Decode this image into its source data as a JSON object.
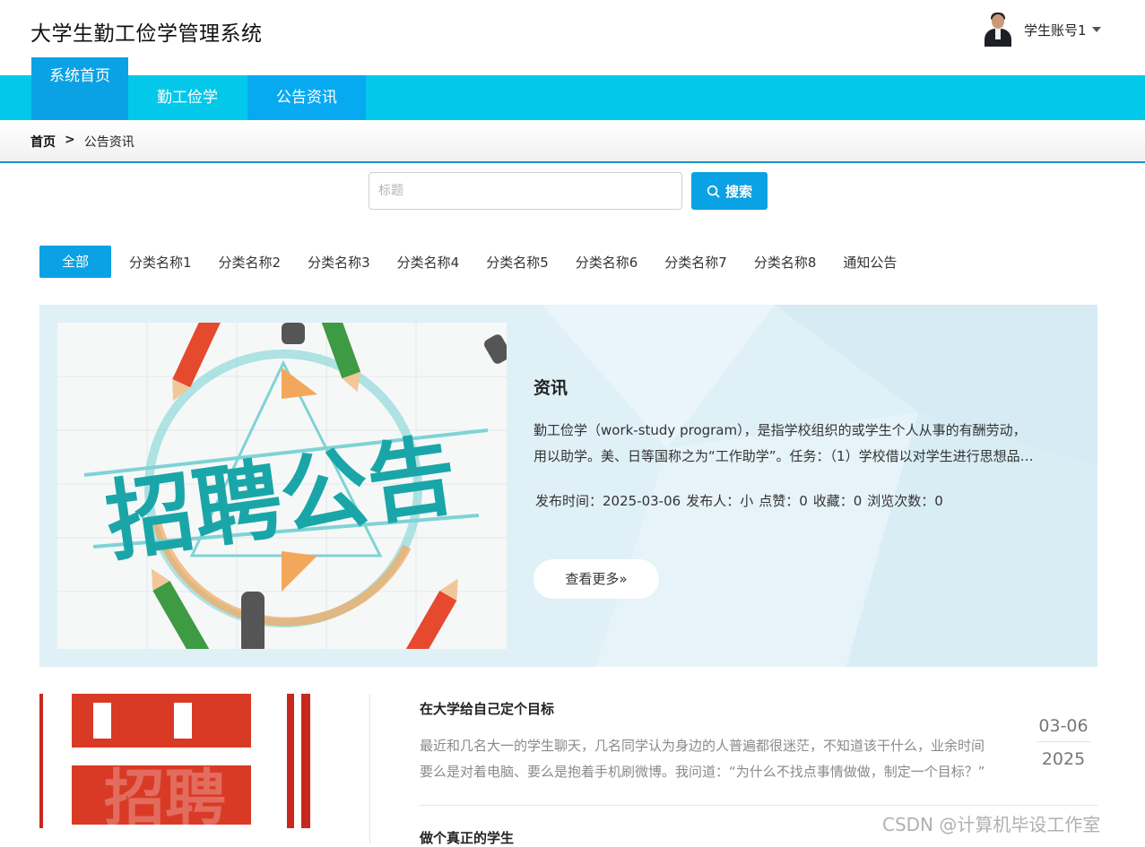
{
  "header": {
    "site_title": "大学生勤工俭学管理系统",
    "user_name": "学生账号1"
  },
  "nav": {
    "tabs": [
      {
        "label": "系统首页"
      },
      {
        "label": "勤工俭学"
      },
      {
        "label": "公告资讯"
      }
    ]
  },
  "breadcrumb": {
    "home": "首页",
    "separator": ">",
    "current": "公告资讯"
  },
  "search": {
    "placeholder": "标题",
    "value": "",
    "button_label": "搜索"
  },
  "categories": {
    "active": "全部",
    "items": [
      "分类名称1",
      "分类名称2",
      "分类名称3",
      "分类名称4",
      "分类名称5",
      "分类名称6",
      "分类名称7",
      "分类名称8",
      "通知公告"
    ]
  },
  "featured": {
    "image_text": "招聘公告",
    "title": "资讯",
    "description": "勤工俭学（work-study program），是指学校组织的或学生个人从事的有酬劳动，用以助学。美、日等国称之为“工作助学”。任务：（1）学校借以对学生进行思想品德教育和劳动教育的重要途径",
    "meta": {
      "publish_time": "发布时间：2025-03-06",
      "publisher": "发布人：小",
      "likes": "点赞：0",
      "favorites": "收藏：0",
      "views": "浏览次数：0"
    },
    "more_label": "查看更多»"
  },
  "list": {
    "items": [
      {
        "image_text": "招聘",
        "title": "在大学给自己定个目标",
        "summary": "最近和几名大一的学生聊天，几名同学认为身边的人普遍都很迷茫，不知道该干什么，业余时间要么是对着电脑、要么是抱着手机刷微博。我问道：“为什么不找点事情做做，制定一个目标？”",
        "date_md": "03-06",
        "date_year": "2025"
      },
      {
        "title": "做个真正的学生"
      }
    ]
  },
  "watermark": "CSDN @计算机毕设工作室",
  "colors": {
    "nav_bg": "#03c8ea",
    "accent": "#0aa2e4",
    "featured_bg": "#dff0f7"
  }
}
